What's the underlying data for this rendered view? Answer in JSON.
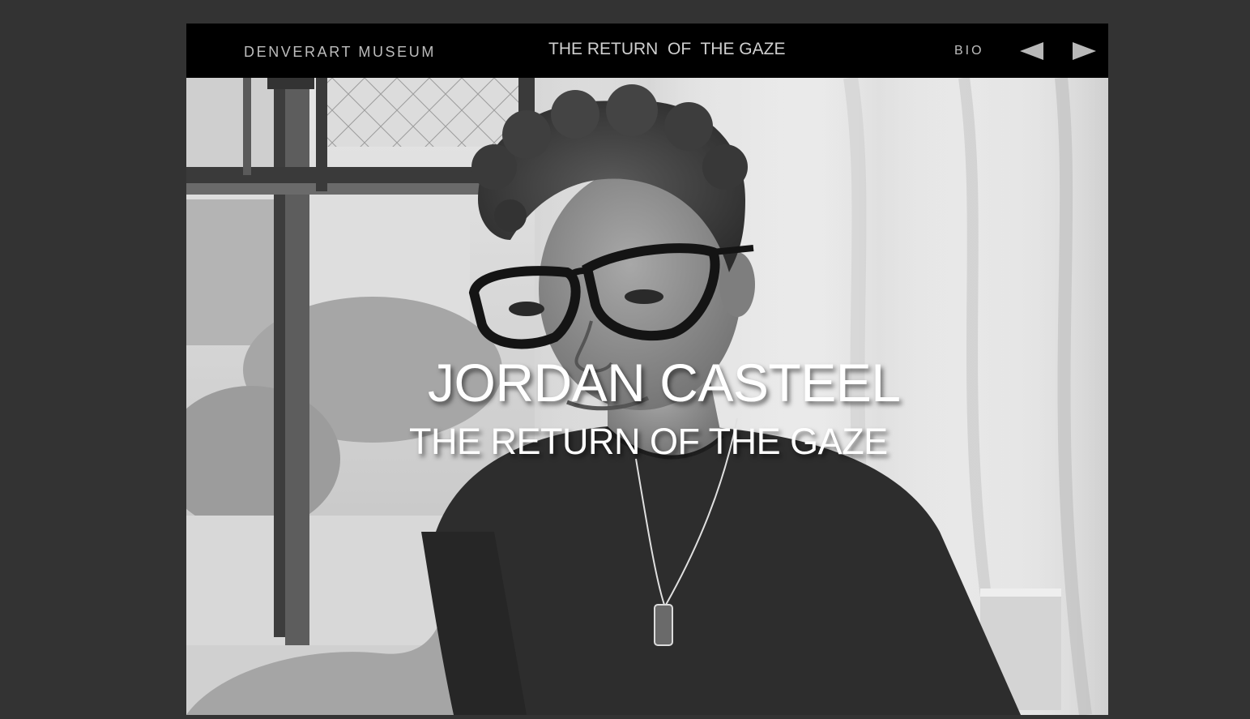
{
  "header": {
    "brand": "DENVERART MUSEUM",
    "title": "THE RETURN  OF  THE GAZE",
    "bio_label": "BIO",
    "prev_icon": "triangle-left-icon",
    "next_icon": "triangle-right-icon"
  },
  "hero": {
    "title": "JORDAN CASTEEL",
    "subtitle": "THE RETURN OF THE GAZE",
    "image": "black-and-white-portrait-photo"
  },
  "colors": {
    "background": "#333333",
    "header_bg": "#000000",
    "header_text": "#bdbdbd",
    "hero_text": "#ffffff"
  }
}
